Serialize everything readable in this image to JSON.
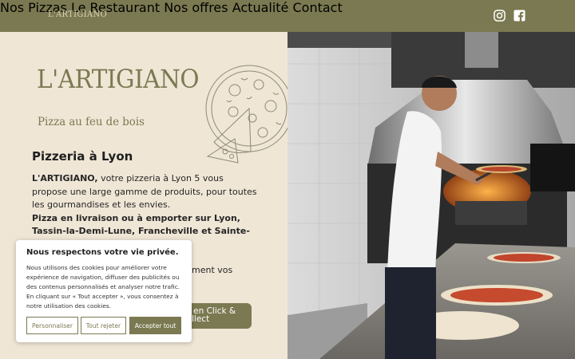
{
  "header": {
    "logo": "L'ARTIGIANO",
    "nav": [
      "Nos Pizzas",
      "Le Restaurant",
      "Nos offres",
      "Actualité",
      "Contact"
    ],
    "social": [
      "instagram-icon",
      "facebook-icon"
    ]
  },
  "hero": {
    "brand": "L'ARTIGIANO",
    "tagline": "Pizza au feu de bois",
    "title": "Pizzeria à Lyon",
    "intro_brand": "L'ARTIGIANO,",
    "intro_text": " votre pizzeria à Lyon 5 vous propose une large gamme de produits, pour toutes les gourmandises et les envies.",
    "intro_bold_line": "Pizza en livraison ou à emporter sur Lyon, Tassin-la-Demi-Lune, Francheville et Sainte-Foy-Lès-",
    "tail_text": "ment vos",
    "cta_line1": "er en Click &",
    "cta_line2": "llect"
  },
  "cookie": {
    "title": "Nous respectons votre vie privée.",
    "text": "Nous utilisons des cookies pour améliorer votre expérience de navigation, diffuser des publicités ou des contenus personnalisés et analyser notre trafic. En cliquant sur « Tout accepter », vous consentez à notre utilisation des cookies.",
    "customize": "Personnaliser",
    "reject": "Tout rejeter",
    "accept": "Accepter tout"
  },
  "colors": {
    "brand": "#7b7951",
    "background": "#efe6d6"
  }
}
